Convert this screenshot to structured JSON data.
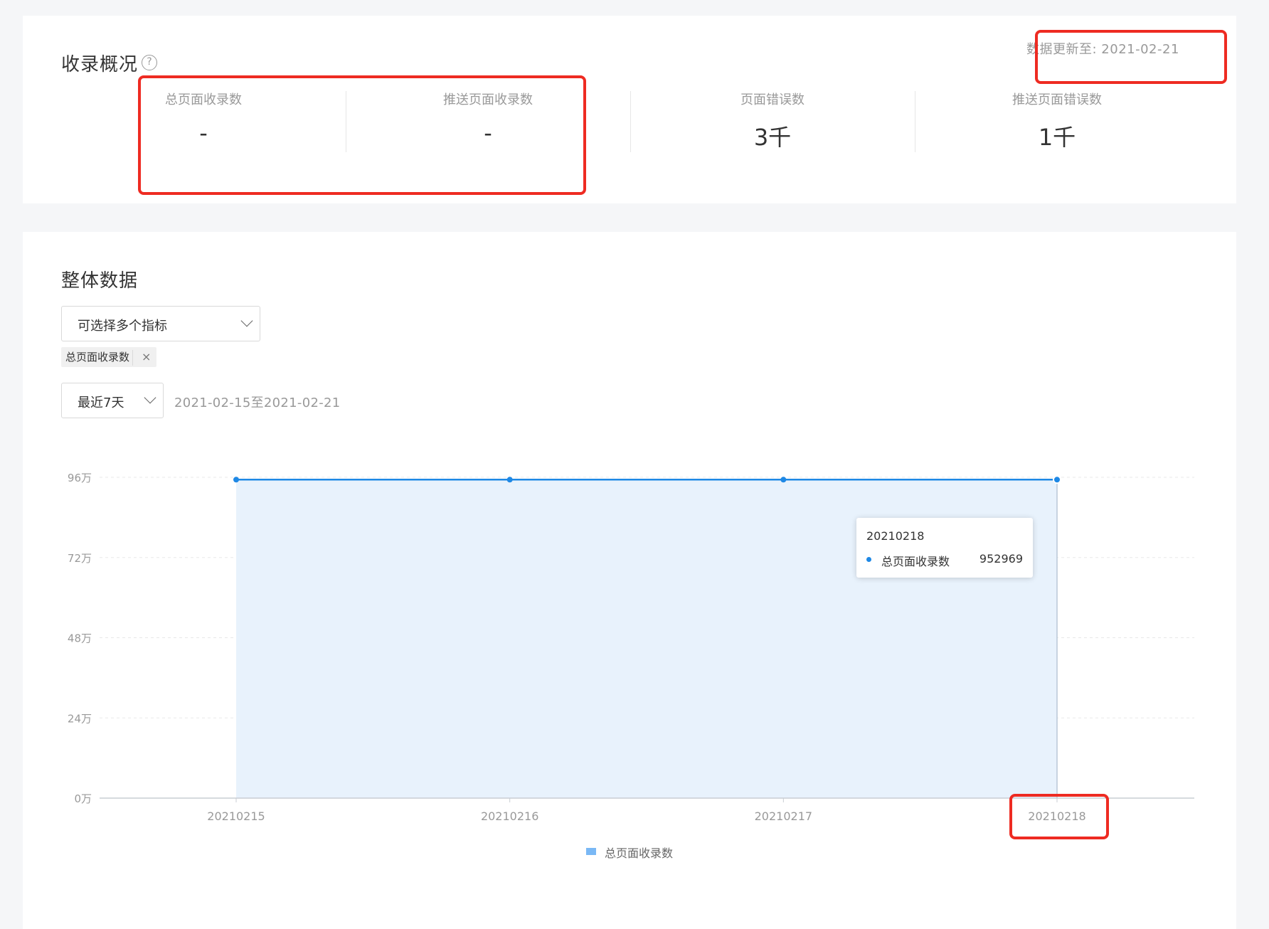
{
  "overview": {
    "title": "收录概况",
    "help_icon": "?",
    "update_text": "数据更新至: 2021-02-21",
    "stats": [
      {
        "label": "总页面收录数",
        "value": "-"
      },
      {
        "label": "推送页面收录数",
        "value": "-"
      },
      {
        "label": "页面错误数",
        "value": "3千"
      },
      {
        "label": "推送页面错误数",
        "value": "1千"
      }
    ]
  },
  "overall": {
    "title": "整体数据",
    "metric_select_placeholder": "可选择多个指标",
    "selected_tag": "总页面收录数",
    "tag_close": "×",
    "period_select": "最近7天",
    "date_range": "2021-02-15至2021-02-21"
  },
  "tooltip": {
    "title": "20210218",
    "series_name": "总页面收录数",
    "value": "952969"
  },
  "legend": {
    "label": "总页面收录数"
  },
  "colors": {
    "line": "#1e88e5",
    "area": "#e8f2fc",
    "highlight": "#ee2b22"
  },
  "chart_data": {
    "type": "area",
    "x": [
      "20210215",
      "20210216",
      "20210217",
      "20210218"
    ],
    "series": [
      {
        "name": "总页面收录数",
        "values": [
          952969,
          952969,
          952969,
          952969
        ]
      }
    ],
    "ylim": [
      0,
      960000
    ],
    "yticks": [
      0,
      240000,
      480000,
      720000,
      960000
    ],
    "ytick_labels": [
      "0万",
      "24万",
      "48万",
      "72万",
      "96万"
    ],
    "grid": true,
    "legend_position": "bottom"
  }
}
